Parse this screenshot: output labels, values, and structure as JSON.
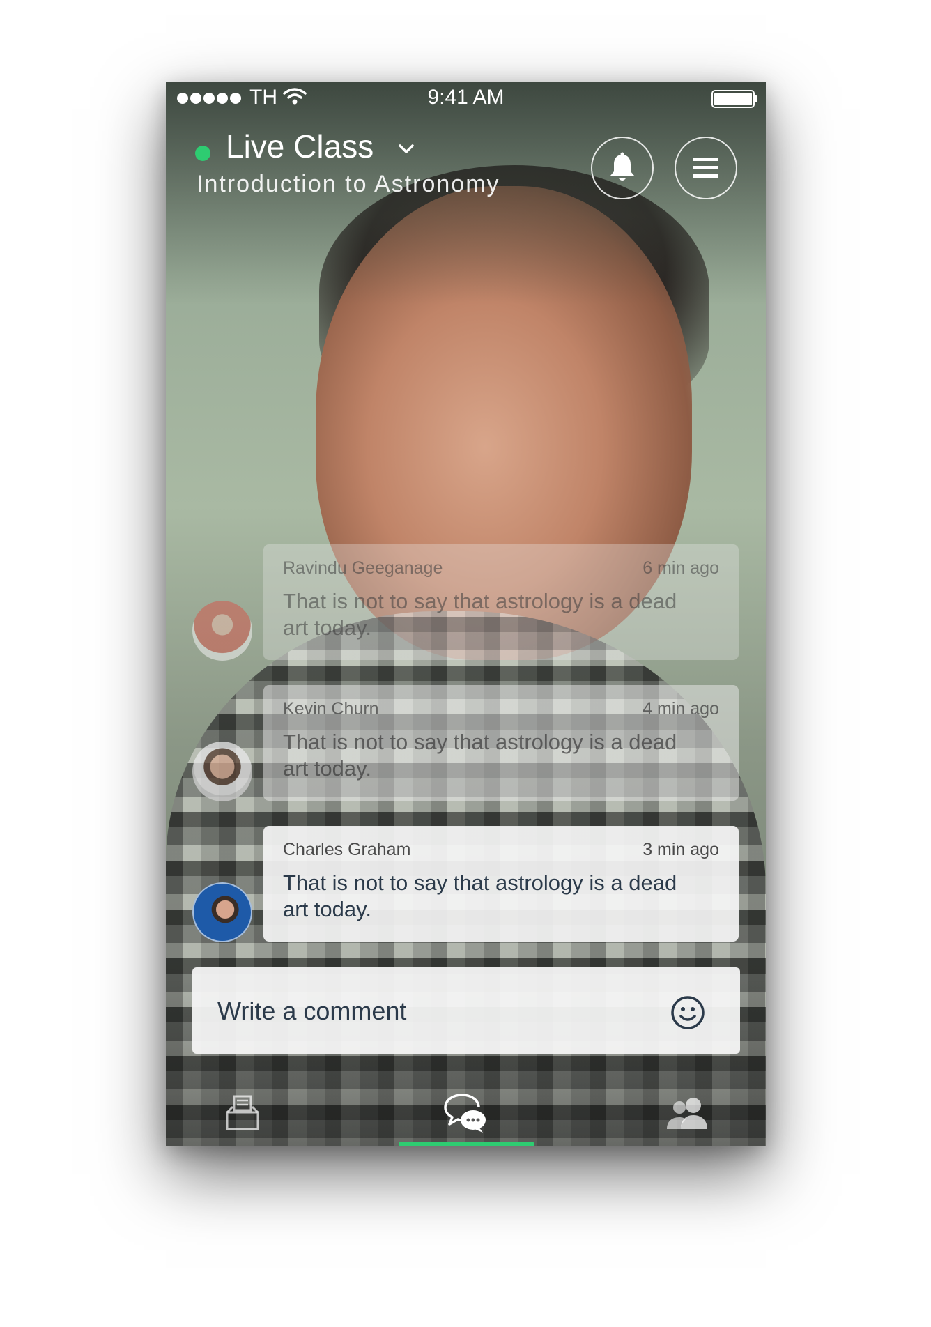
{
  "status_bar": {
    "carrier": "TH",
    "time": "9:41 AM"
  },
  "header": {
    "title": "Live Class",
    "subtitle": "Introduction to Astronomy",
    "live_color": "#2ecc71"
  },
  "comments": [
    {
      "author": "Ravindu Geeganage",
      "time": "6 min ago",
      "text": "That is not to say that astrology is a dead art today."
    },
    {
      "author": "Kevin Churn",
      "time": "4 min ago",
      "text": "That is not to say that astrology is a dead art today."
    },
    {
      "author": "Charles Graham",
      "time": "3 min ago",
      "text": "That is not to say that astrology is a dead art today."
    }
  ],
  "comment_input": {
    "placeholder": "Write a comment"
  },
  "nav": {
    "tabs": [
      {
        "icon": "archive-icon",
        "active": false
      },
      {
        "icon": "chat-icon",
        "active": true
      },
      {
        "icon": "people-icon",
        "active": false
      }
    ],
    "accent": "#2ecc71"
  }
}
